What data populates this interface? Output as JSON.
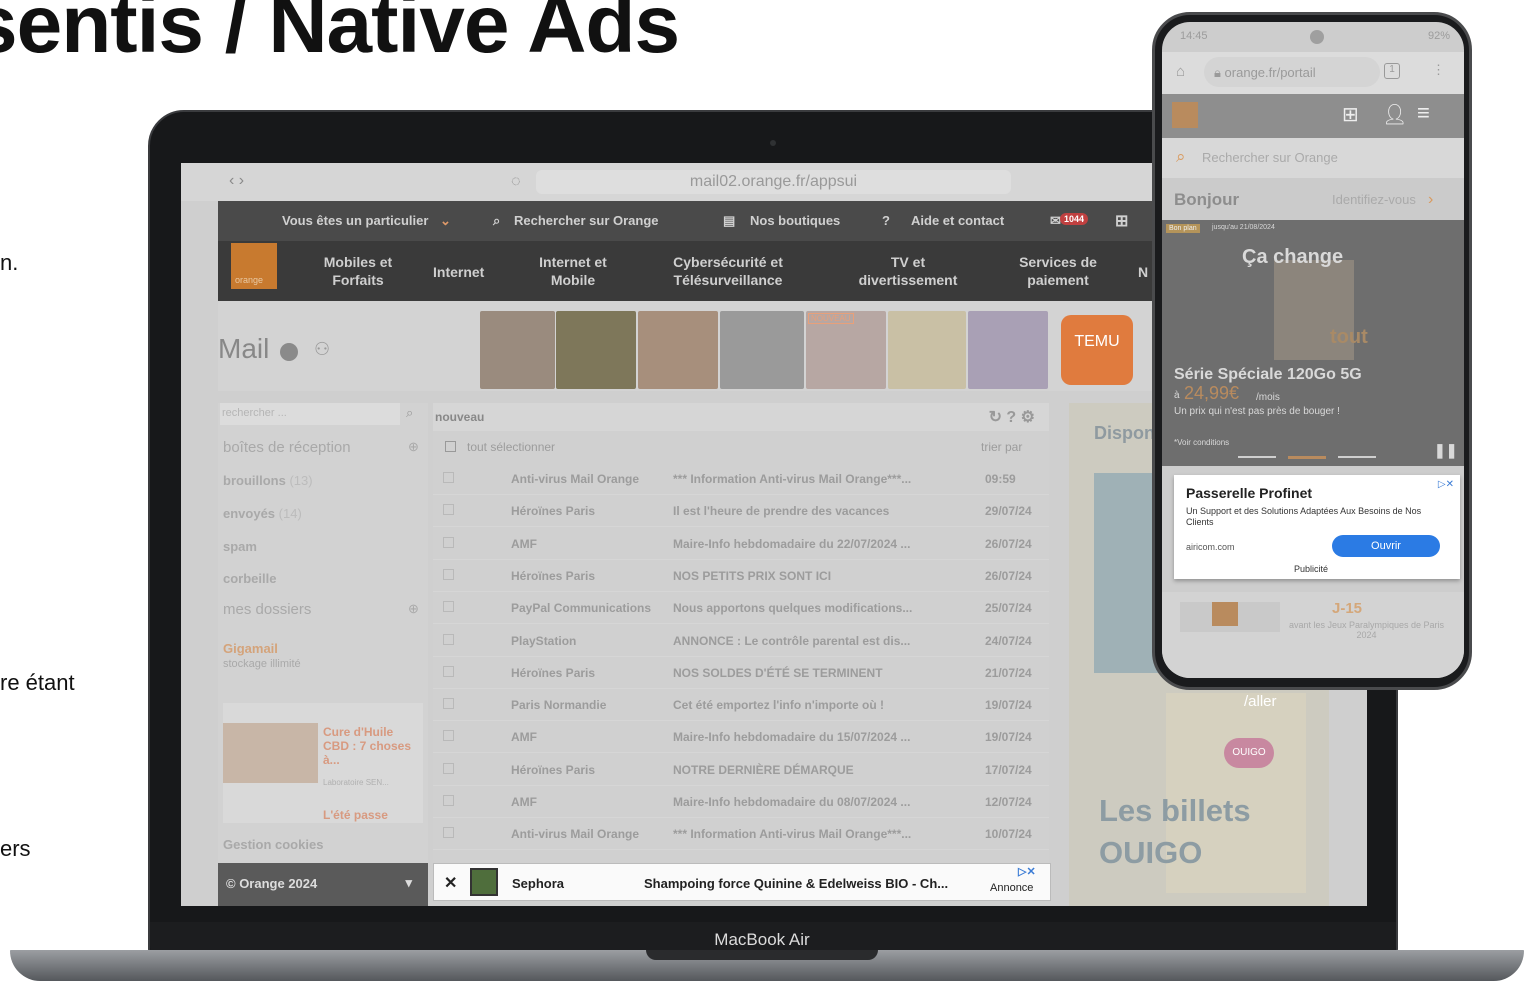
{
  "slide": {
    "title": "sentis / Native Ads",
    "frag1": "n.",
    "frag2": "re étant",
    "frag3": "ers"
  },
  "laptop": {
    "label": "MacBook Air"
  },
  "browser": {
    "nav": "‹  ›",
    "url": "mail02.orange.fr/appsui"
  },
  "topnav": {
    "particulier": "Vous êtes un particulier",
    "search": "Rechercher sur Orange",
    "boutiques": "Nos boutiques",
    "aide": "Aide et contact",
    "badge": "1044"
  },
  "mainnav": {
    "logo": "orange",
    "items": [
      "Mobiles et\nForfaits",
      "Internet",
      "Internet et\nMobile",
      "Cybersécurité et\nTélésurveillance",
      "TV et\ndivertissement",
      "Services de\npaiement",
      "N"
    ]
  },
  "mail": {
    "title": "Mail",
    "search_placeholder": "rechercher ...",
    "folder": "nouveau",
    "select_all": "tout sélectionner",
    "sort": "trier par",
    "folders": {
      "inbox": "boîtes de réception",
      "drafts": "brouillons",
      "drafts_count": "(13)",
      "sent": "envoyés",
      "sent_count": "(14)",
      "spam": "spam",
      "trash": "corbeille",
      "mydirs": "mes dossiers"
    },
    "gigamail": "Gigamail",
    "gigamail_sub": "stockage illimité",
    "side_ad": {
      "title": "Cure d'Huile CBD : 7 choses à...",
      "source": "Laboratoire SEN...",
      "title2": "L'été passe"
    },
    "cookies": "Gestion cookies",
    "copyright": "© Orange 2024",
    "rows": [
      {
        "sender": "Anti-virus Mail Orange",
        "subject": "*** Information Anti-virus Mail Orange***...",
        "date": "09:59"
      },
      {
        "sender": "Héroïnes Paris",
        "subject": "Il est l'heure de prendre des vacances",
        "date": "29/07/24"
      },
      {
        "sender": "AMF",
        "subject": "Maire-Info hebdomadaire du 22/07/2024 ...",
        "date": "26/07/24"
      },
      {
        "sender": "Héroïnes Paris",
        "subject": "NOS PETITS PRIX SONT ICI",
        "date": "26/07/24"
      },
      {
        "sender": "PayPal Communications",
        "subject": "Nous apportons quelques modifications...",
        "date": "25/07/24"
      },
      {
        "sender": "PlayStation",
        "subject": "ANNONCE : Le contrôle parental est dis...",
        "date": "24/07/24"
      },
      {
        "sender": "Héroïnes Paris",
        "subject": "NOS SOLDES D'ÉTÉ SE TERMINENT",
        "date": "21/07/24"
      },
      {
        "sender": "Paris Normandie",
        "subject": "Cet été emportez l'info n'importe où !",
        "date": "19/07/24"
      },
      {
        "sender": "AMF",
        "subject": "Maire-Info hebdomadaire du 15/07/2024 ...",
        "date": "19/07/24"
      },
      {
        "sender": "Héroïnes Paris",
        "subject": "NOTRE DERNIÈRE DÉMARQUE",
        "date": "17/07/24"
      },
      {
        "sender": "AMF",
        "subject": "Maire-Info hebdomadaire du 08/07/2024 ...",
        "date": "12/07/24"
      },
      {
        "sender": "Anti-virus Mail Orange",
        "subject": "*** Information Anti-virus Mail Orange***...",
        "date": "10/07/24"
      }
    ],
    "native_ad": {
      "close": "✕",
      "sender": "Sephora",
      "subject": "Shampoing force Quinine & Edelweiss BIO - Ch...",
      "label": "Annonce"
    },
    "banner_ad": {
      "temu": "TEMU",
      "nouveau": "NOUVEAU"
    },
    "right_ad": {
      "dispo": "Dispon",
      "aller": "/aller",
      "brand": "OUIGO",
      "headline1": "Les billets",
      "headline2": "OUIGO"
    }
  },
  "phone": {
    "time": "14:45",
    "battery": "92%",
    "url": "orange.fr/portail",
    "tabs": "1",
    "search": "Rechercher sur Orange",
    "hello": "Bonjour",
    "login": "Identifiez-vous",
    "tag": "Bon plan",
    "tag_date": "jusqu'au 21/08/2024",
    "promo_title": "Ça change",
    "promo_word": "tout",
    "offer": "Série Spéciale 120Go 5G",
    "price_prefix": "à",
    "price": "24,99€",
    "per": "/mois",
    "tagline": "Un prix qui n'est pas près de bouger !",
    "conditions": "*Voir conditions",
    "ad_title": "Passerelle Profinet",
    "ad_text": "Un Support et des Solutions Adaptées Aux Besoins de Nos Clients",
    "ad_domain": "airicom.com",
    "ad_button": "Ouvrir",
    "ad_label": "Publicité",
    "countdown": "J-15",
    "countdown_text": "avant les Jeux Paralympiques de Paris 2024"
  }
}
